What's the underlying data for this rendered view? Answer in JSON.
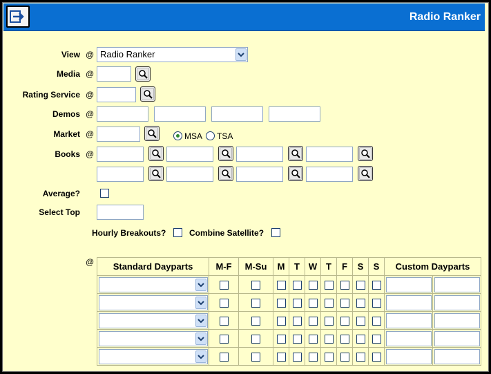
{
  "window": {
    "title": "Radio Ranker"
  },
  "form": {
    "view_label": "View",
    "view_value": "Radio Ranker",
    "media_label": "Media",
    "rating_service_label": "Rating Service",
    "demos_label": "Demos",
    "market_label": "Market",
    "msa_label": "MSA",
    "tsa_label": "TSA",
    "market_area_selected": "MSA",
    "books_label": "Books",
    "average_label": "Average?",
    "select_top_label": "Select Top",
    "hourly_breakouts_label": "Hourly Breakouts?",
    "combine_satellite_label": "Combine Satellite?",
    "at_symbol": "@"
  },
  "dayparts": {
    "headers": [
      "Standard Dayparts",
      "M-F",
      "M-Su",
      "M",
      "T",
      "W",
      "T",
      "F",
      "S",
      "S",
      "Custom Dayparts"
    ],
    "row_count": 5
  },
  "icons": {
    "go": "arrow-right-icon",
    "lookup": "magnifier-icon",
    "dropdown": "chevron-down-icon"
  },
  "colors": {
    "titlebar": "#0a6fd2",
    "background": "#ffffcc",
    "frame": "#000000"
  }
}
